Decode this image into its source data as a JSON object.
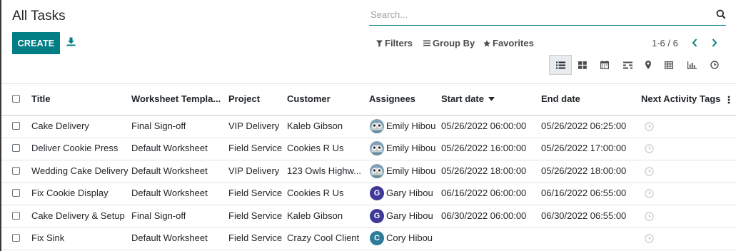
{
  "header": {
    "title": "All Tasks"
  },
  "search": {
    "placeholder": "Search..."
  },
  "toolbar": {
    "create_label": "CREATE"
  },
  "filters": {
    "filters_label": "Filters",
    "group_by_label": "Group By",
    "favorites_label": "Favorites"
  },
  "pager": {
    "value": "1-6 / 6"
  },
  "views": [
    "list",
    "kanban",
    "calendar",
    "gantt",
    "map",
    "pivot",
    "graph",
    "activity"
  ],
  "table": {
    "columns": [
      "Title",
      "Worksheet Templa...",
      "Project",
      "Customer",
      "Assignees",
      "Start date",
      "End date",
      "Next Activity",
      "Tags"
    ],
    "rows": [
      {
        "title": "Cake Delivery",
        "worksheet": "Final Sign-off",
        "project": "VIP Delivery",
        "customer": "Kaleb Gibson",
        "assignee": "Emily Hibou",
        "start": "05/26/2022 06:00:00",
        "end": "05/26/2022 06:25:00"
      },
      {
        "title": "Deliver Cookie Press",
        "worksheet": "Default Worksheet",
        "project": "Field Service",
        "customer": "Cookies R Us",
        "assignee": "Emily Hibou",
        "start": "05/26/2022 16:00:00",
        "end": "05/26/2022 17:00:00"
      },
      {
        "title": "Wedding Cake Delivery",
        "worksheet": "Default Worksheet",
        "project": "VIP Delivery",
        "customer": "123 Owls Highw...",
        "assignee": "Emily Hibou",
        "start": "05/26/2022 18:00:00",
        "end": "05/26/2022 18:00:00"
      },
      {
        "title": "Fix Cookie Display",
        "worksheet": "Default Worksheet",
        "project": "Field Service",
        "customer": "Cookies R Us",
        "assignee": "Gary Hibou",
        "avatar_letter": "G",
        "start": "06/16/2022 06:00:00",
        "end": "06/16/2022 06:55:00"
      },
      {
        "title": "Cake Delivery & Setup",
        "worksheet": "Final Sign-off",
        "project": "Field Service",
        "customer": "Kaleb Gibson",
        "assignee": "Gary Hibou",
        "avatar_letter": "G",
        "start": "06/30/2022 06:00:00",
        "end": "06/30/2022 06:55:00"
      },
      {
        "title": "Fix Sink",
        "worksheet": "Default Worksheet",
        "project": "Field Service",
        "customer": "Crazy Cool Client",
        "assignee": "Cory Hibou",
        "avatar_letter": "C",
        "start": "",
        "end": ""
      }
    ]
  },
  "colors": {
    "accent": "#017e84",
    "avatar_g": "#3f3a98",
    "avatar_c": "#2d7d9a",
    "clock": "#c8c8c8"
  }
}
